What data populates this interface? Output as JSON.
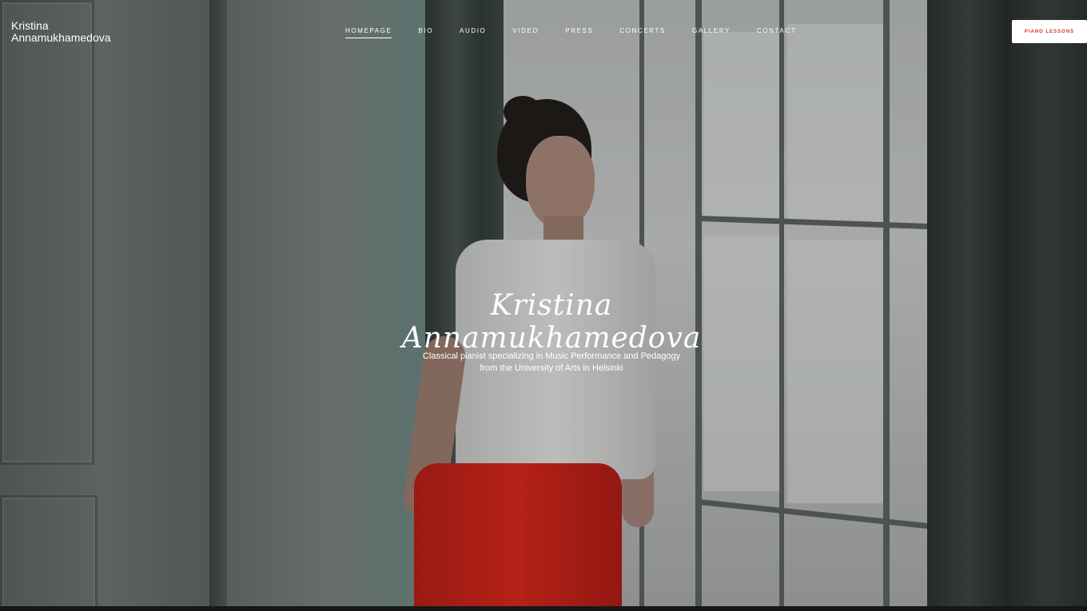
{
  "header": {
    "brand_line1": "Kristina",
    "brand_line2": "Annamukhamedova",
    "nav": [
      {
        "label": "HOMEPAGE",
        "active": true
      },
      {
        "label": "BIO",
        "active": false
      },
      {
        "label": "AUDIO",
        "active": false
      },
      {
        "label": "VIDEO",
        "active": false
      },
      {
        "label": "PRESS",
        "active": false
      },
      {
        "label": "CONCERTS",
        "active": false
      },
      {
        "label": "GALLERY",
        "active": false
      },
      {
        "label": "CONTACT",
        "active": false
      }
    ],
    "cta_label": "PIANO LESSONS"
  },
  "hero": {
    "title": "Kristina Annamukhamedova",
    "subtitle_line1": "Classical pianist specializing in Music Performance and Pedagogy",
    "subtitle_line2": "from the University of Arts in Helsinki",
    "image": "hero-photo-woman-by-window"
  },
  "colors": {
    "accent": "#d3352b",
    "text": "#ffffff",
    "pants": "#d9261a"
  }
}
